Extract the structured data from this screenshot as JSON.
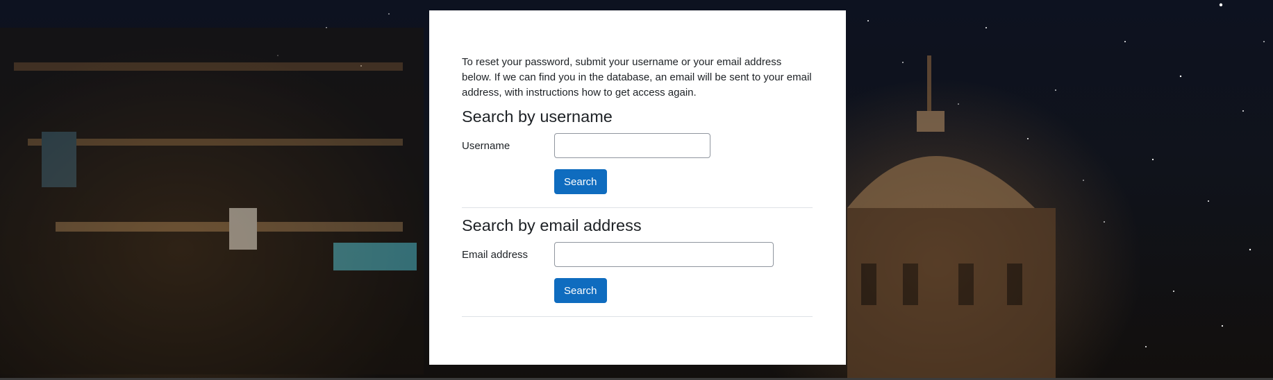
{
  "intro_text": "To reset your password, submit your username or your email address below. If we can find you in the database, an email will be sent to your email address, with instructions how to get access again.",
  "username_section": {
    "title": "Search by username",
    "field_label": "Username",
    "field_value": "",
    "button_label": "Search"
  },
  "email_section": {
    "title": "Search by email address",
    "field_label": "Email address",
    "field_value": "",
    "button_label": "Search"
  },
  "colors": {
    "primary_button": "#0f6cbf",
    "card_background": "#ffffff",
    "text": "#1d2125",
    "divider": "#dee2e6"
  }
}
